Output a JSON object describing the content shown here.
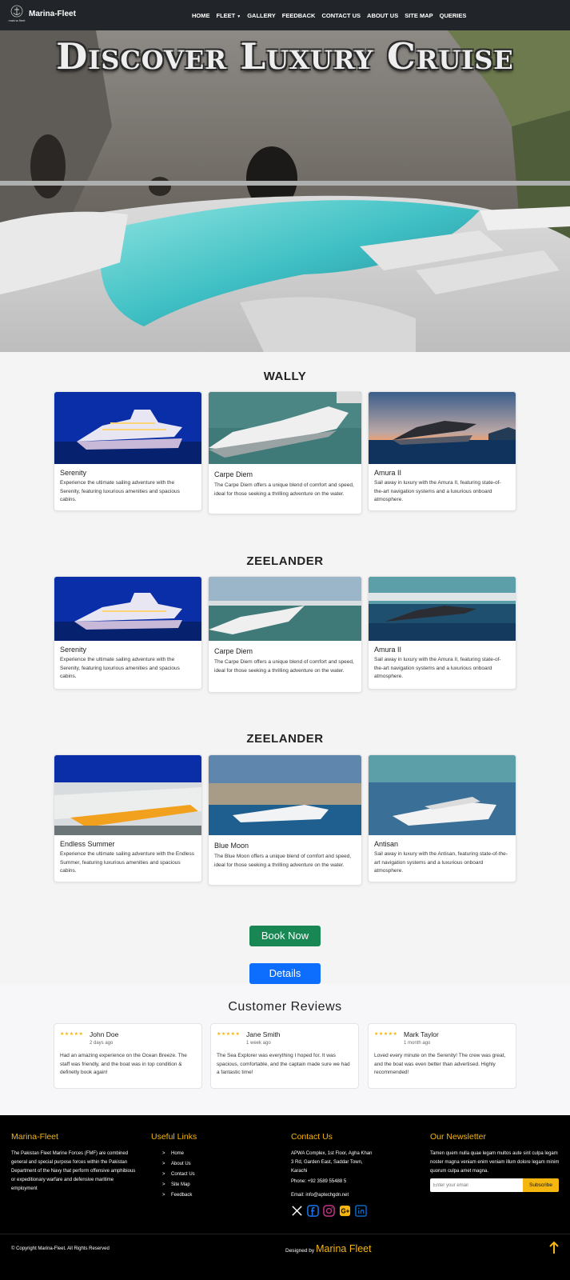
{
  "navbar": {
    "logo_caption": "marina fleet",
    "brand": "Marina-Fleet",
    "links": [
      {
        "label": "HOME"
      },
      {
        "label": "FLEET",
        "has_dropdown": true
      },
      {
        "label": "GALLERY"
      },
      {
        "label": "FEEDBACK"
      },
      {
        "label": "CONTACT US"
      },
      {
        "label": "ABOUT US"
      },
      {
        "label": "SITE MAP"
      },
      {
        "label": "QUERIES"
      }
    ]
  },
  "hero": {
    "title": "Discover Luxury Cruise"
  },
  "sections": [
    {
      "title": "WALLY",
      "cards": [
        {
          "name": "Serenity",
          "text": "Experience the ultimate sailing adventure with the Serenity, featuring luxurious amenities and spacious cabins."
        },
        {
          "name": "Carpe Diem",
          "text": "The Carpe Diem offers a unique blend of comfort and speed, ideal for those seeking a thrilling adventure on the water."
        },
        {
          "name": "Amura II",
          "text": "Sail away in luxury with the Amura II, featuring state-of-the-art navigation systems and a luxurious onboard atmosphere."
        }
      ]
    },
    {
      "title": "ZEELANDER",
      "cards": [
        {
          "name": "Serenity",
          "text": "Experience the ultimate sailing adventure with the Serenity, featuring luxurious amenities and spacious cabins."
        },
        {
          "name": "Carpe Diem",
          "text": "The Carpe Diem offers a unique blend of comfort and speed, ideal for those seeking a thrilling adventure on the water."
        },
        {
          "name": "Amura II",
          "text": "Sail away in luxury with the Amura II, featuring state-of-the-art navigation systems and a luxurious onboard atmosphere."
        }
      ]
    },
    {
      "title": "ZEELANDER",
      "cards": [
        {
          "name": "Endless Summer",
          "text": "Experience the ultimate sailing adventure with the Endless Summer, featuring luxurious amenities and spacious cabins."
        },
        {
          "name": "Blue Moon",
          "text": "The Blue Moon offers a unique blend of comfort and speed, ideal for those seeking a thrilling adventure on the water."
        },
        {
          "name": "Antisan",
          "text": "Sail away in luxury with the Antisan, featuring state-of-the-art navigation systems and a luxurious onboard atmosphere."
        }
      ]
    }
  ],
  "buttons": {
    "book_now": "Book Now",
    "details": "Details"
  },
  "reviews": {
    "title": "Customer Reviews",
    "items": [
      {
        "stars": "★★★★★",
        "name": "John Doe",
        "time": "2 days ago",
        "text": "Had an amazing experience on the Ocean Breeze. The staff was friendly, and the boat was in top condition & definetly book again!"
      },
      {
        "stars": "★★★★★",
        "name": "Jane Smith",
        "time": "1 week ago",
        "text": "The Sea Explorer was everything I hoped for. It was spacious, comfortable, and the captain made sure we had a fantastic time!"
      },
      {
        "stars": "★★★★★",
        "name": "Mark Taylor",
        "time": "1 month ago",
        "text": "Loved every minute on the Serenity! The crew was great, and the boat was even better than advertised. Highly recommended!"
      }
    ]
  },
  "footer": {
    "about": {
      "heading": "Marina-Fleet",
      "text": "The Pakistan Fleet Marine Forces (FMF) are combined general and special purpose forces within the Pakistan Department of the Navy that perform offensive amphibious or expeditionary warfare and defensive maritime employment"
    },
    "links": {
      "heading": "Useful Links",
      "bullet": ">",
      "items": [
        "Home",
        "About Us",
        "Contact Us",
        "Site Map",
        "Feedback"
      ]
    },
    "contact": {
      "heading": "Contact Us",
      "address": "APWA Complex, 1st Floor, Agha Khan 3 Rd, Garden East, Saddar Town, Karachi",
      "phone": "Phone: +92 3589 55488 5",
      "email": "Email: info@aptechgdn.net"
    },
    "newsletter": {
      "heading": "Our Newsletter",
      "text": "Tamen quem nulla quae legam multos aute sint culpa legam noster magna veniam enim veniam illum dolore legam minim quorum culpa amet magna.",
      "placeholder": "Enter your email",
      "button": "Subscribe"
    },
    "social_icons": [
      "x-icon",
      "facebook-icon",
      "instagram-icon",
      "google-plus-icon",
      "linkedin-icon"
    ],
    "social_colors": {
      "x": "#ffffff",
      "facebook": "#1877f2",
      "instagram": "#c13584",
      "google_plus": "#f5b60f",
      "linkedin": "#0a66c2"
    },
    "copyright": "© Copyright Marina-Fleet. All Rights Reserved",
    "designed_by": "Designed by",
    "designed_brand": "Marina Fleet"
  },
  "colors": {
    "navbar_bg": "#212529",
    "accent_gold": "#f5b60f",
    "book_now": "#198754",
    "details": "#0d6efd"
  }
}
